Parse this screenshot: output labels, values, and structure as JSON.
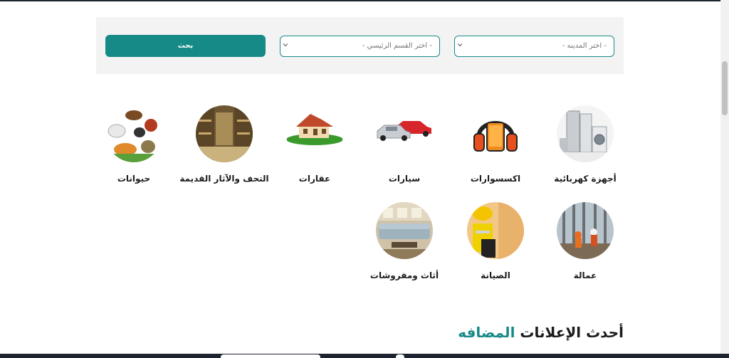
{
  "search": {
    "city_placeholder": "- اختر المدينه -",
    "section_placeholder": "- اختر القسم الرئيسي -",
    "button_label": "بحث"
  },
  "categories": [
    {
      "label": "أجهزة كهربائية",
      "icon": "appliances-image"
    },
    {
      "label": "اكسسوارات",
      "icon": "headphones-phone-image"
    },
    {
      "label": "سيارات",
      "icon": "cars-image"
    },
    {
      "label": "عقارات",
      "icon": "house-image"
    },
    {
      "label": "التحف والآثار القديمة",
      "icon": "antiques-shop-image"
    },
    {
      "label": "حيوانات",
      "icon": "animals-image"
    },
    {
      "label": "عمالة",
      "icon": "workers-image"
    },
    {
      "label": "الصيانة",
      "icon": "maintenance-worker-image"
    },
    {
      "label": "أثاث ومفروشات",
      "icon": "furniture-room-image"
    }
  ],
  "latest": {
    "title_main": "أحدث الإعلانات",
    "title_accent": "المضافه"
  },
  "colors": {
    "accent": "#168a86",
    "panel_bg": "#f3f3f3"
  }
}
